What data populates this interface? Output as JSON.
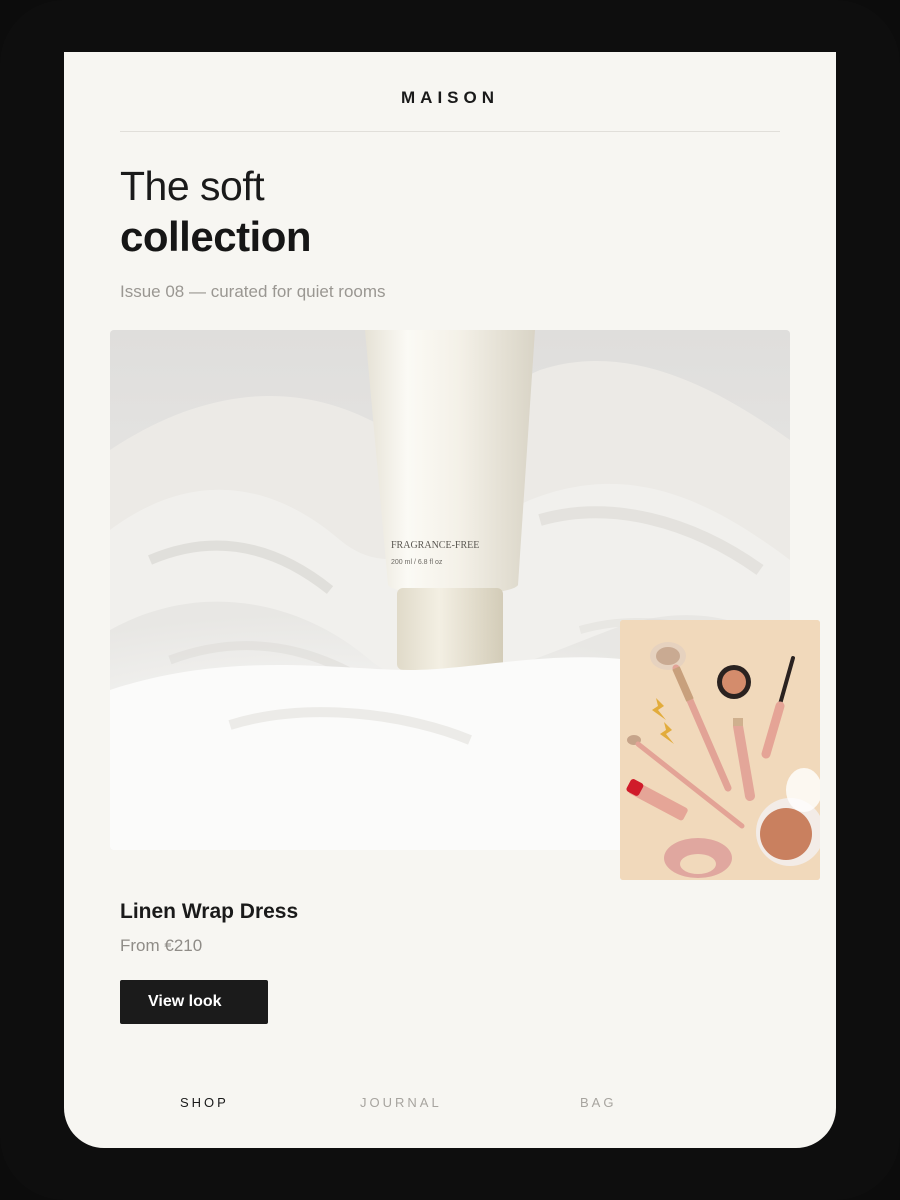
{
  "brand": "MAISON",
  "headline": {
    "line1": "The soft",
    "line2": "collection"
  },
  "subtitle": "Issue 08 — curated for quiet rooms",
  "hero": {
    "bottle_label": "FRAGRANCE-FREE",
    "bottle_sublabel": "200 ml / 6.8 fl oz"
  },
  "product": {
    "name": "Linen Wrap Dress",
    "price": "From €210",
    "cta_label": "View look"
  },
  "tabs": [
    {
      "label": "SHOP",
      "active": true
    },
    {
      "label": "JOURNAL",
      "active": false
    },
    {
      "label": "BAG",
      "active": false
    }
  ],
  "colors": {
    "background": "#f7f6f2",
    "ink": "#1b1b1b",
    "muted": "#9a9792",
    "bezel": "#0e0e0e",
    "thumb_bg": "#f1d9bb"
  }
}
